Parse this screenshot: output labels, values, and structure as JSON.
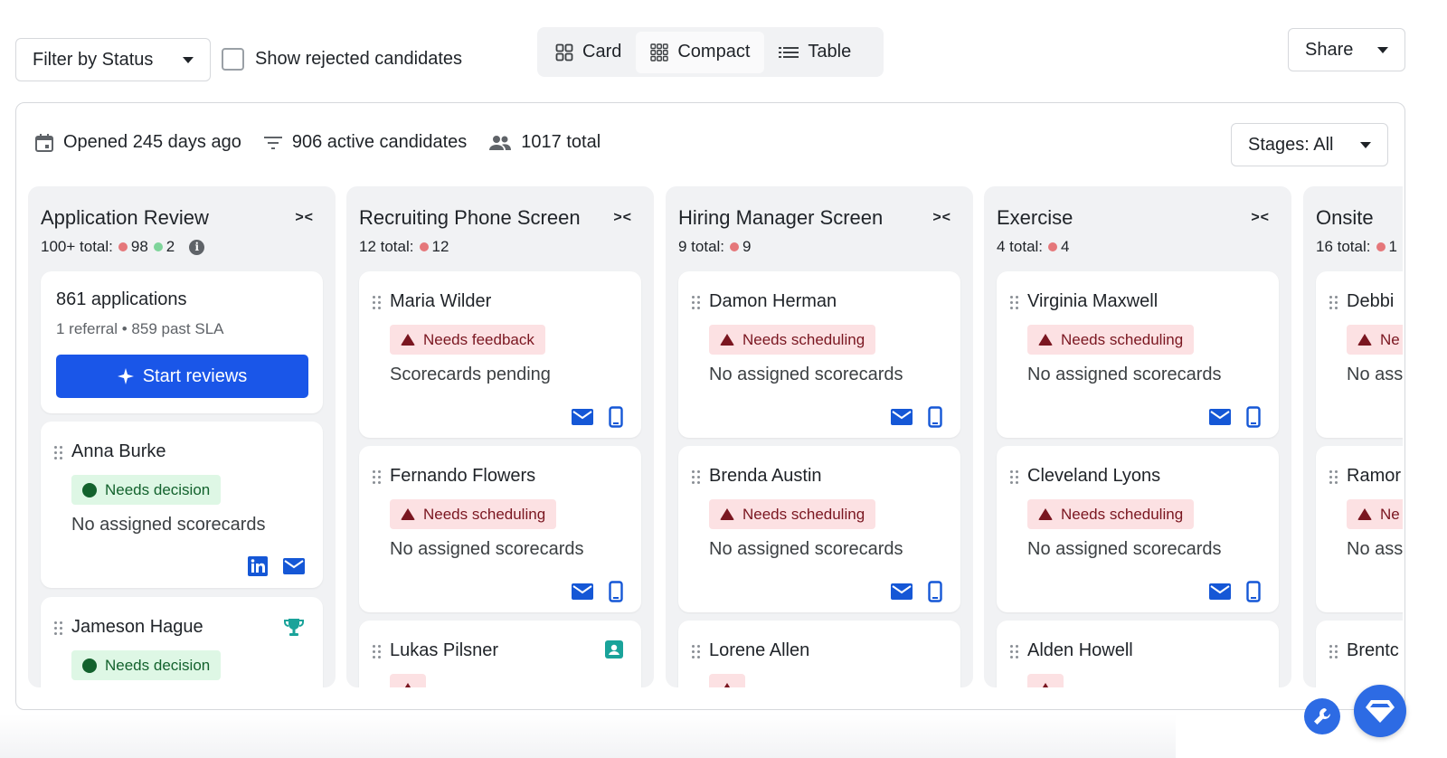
{
  "toolbar": {
    "filter_label": "Filter by Status",
    "show_rejected_label": "Show rejected candidates",
    "views": [
      {
        "label": "Card",
        "icon": "card-grid-icon",
        "active": false
      },
      {
        "label": "Compact",
        "icon": "compact-grid-icon",
        "active": true
      },
      {
        "label": "Table",
        "icon": "list-icon",
        "active": false
      }
    ],
    "share_label": "Share"
  },
  "stats": {
    "opened": "Opened 245 days ago",
    "active": "906 active candidates",
    "total": "1017 total",
    "stages_label": "Stages: All"
  },
  "colors": {
    "primary": "#1a56e8",
    "column_bg": "#f1f2f4",
    "warning_bg": "#fce1e3",
    "warning_text": "#7a1620",
    "success_bg": "#def7e5",
    "success_text": "#13622d",
    "icon_blue": "#1557d6",
    "teal": "#1aa39a"
  },
  "columns": [
    {
      "title": "Application Review",
      "total_label": "100+ total:",
      "red_count": "98",
      "green_count": "2",
      "summary": {
        "title": "861 applications",
        "subtitle": "1 referral • 859 past SLA",
        "button": "Start reviews"
      },
      "cards": [
        {
          "name": "Anna Burke",
          "status": "Needs decision",
          "scorecards": "No assigned scorecards"
        },
        {
          "name": "Jameson Hague",
          "status": "Needs decision"
        }
      ]
    },
    {
      "title": "Recruiting Phone Screen",
      "total_label": "12 total:",
      "red_count": "12",
      "cards": [
        {
          "name": "Maria Wilder",
          "status": "Needs feedback",
          "scorecards": "Scorecards pending"
        },
        {
          "name": "Fernando Flowers",
          "status": "Needs scheduling",
          "scorecards": "No assigned scorecards"
        },
        {
          "name": "Lukas Pilsner"
        }
      ]
    },
    {
      "title": "Hiring Manager Screen",
      "total_label": "9 total:",
      "red_count": "9",
      "cards": [
        {
          "name": "Damon Herman",
          "status": "Needs scheduling",
          "scorecards": "No assigned scorecards"
        },
        {
          "name": "Brenda Austin",
          "status": "Needs scheduling",
          "scorecards": "No assigned scorecards"
        },
        {
          "name": "Lorene Allen"
        }
      ]
    },
    {
      "title": "Exercise",
      "total_label": "4 total:",
      "red_count": "4",
      "cards": [
        {
          "name": "Virginia Maxwell",
          "status": "Needs scheduling",
          "scorecards": "No assigned scorecards"
        },
        {
          "name": "Cleveland Lyons",
          "status": "Needs scheduling",
          "scorecards": "No assigned scorecards"
        },
        {
          "name": "Alden Howell"
        }
      ]
    },
    {
      "title": "Onsite",
      "total_label": "16 total:",
      "red_count": "1",
      "cards": [
        {
          "name": "Debbi",
          "status": "Ne",
          "scorecards": "No ass"
        },
        {
          "name": "Ramor",
          "status": "Ne",
          "scorecards": "No ass"
        },
        {
          "name": "Brentc"
        }
      ]
    }
  ]
}
